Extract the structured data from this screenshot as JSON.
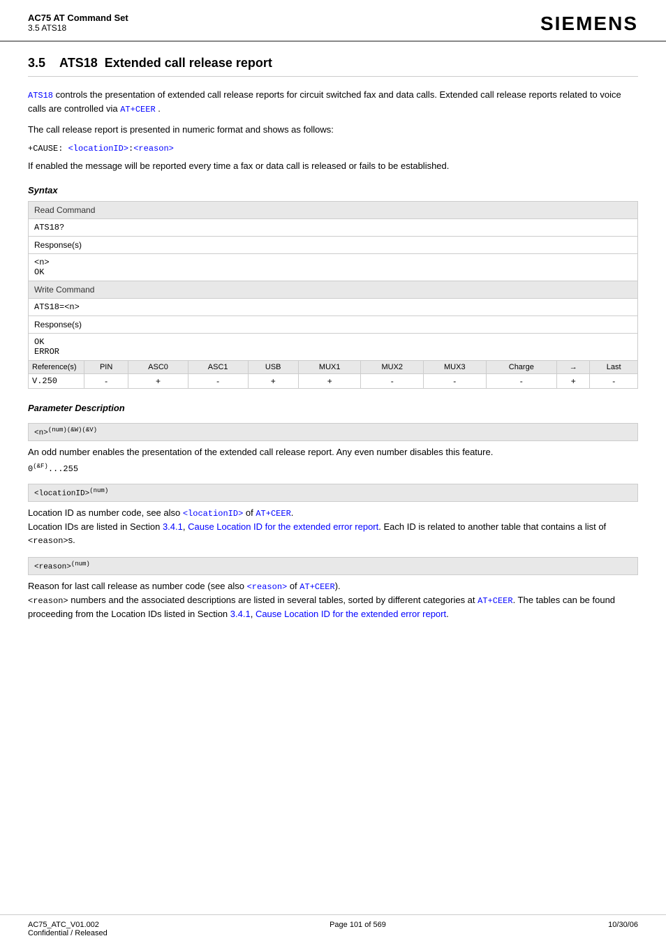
{
  "header": {
    "title": "AC75 AT Command Set",
    "subtitle": "3.5 ATS18",
    "logo": "SIEMENS"
  },
  "section": {
    "number": "3.5",
    "command": "ATS18",
    "title": "Extended call release report"
  },
  "body": {
    "para1_before": "controls the presentation of extended call release reports for circuit switched fax and data calls. Extended call release reports related to voice calls are controlled via",
    "para1_link1": "ATS18",
    "para1_link2": "AT+CEER",
    "para2": "The call release report is presented in numeric format and shows as follows:",
    "code_line": "+CAUSE: <locationID>:<reason>",
    "para3": "If enabled the message will be reported every time a fax or data call is released or fails to be established.",
    "syntax_heading": "Syntax",
    "param_desc_heading": "Parameter Description"
  },
  "syntax_table": {
    "read_command_label": "Read Command",
    "read_command": "ATS18?",
    "read_response_label": "Response(s)",
    "read_response_line1": "<n>",
    "read_response_line2": "OK",
    "write_command_label": "Write Command",
    "write_command": "ATS18=<n>",
    "write_response_label": "Response(s)",
    "write_response_line1": "OK",
    "write_response_line2": "ERROR",
    "ref_label": "Reference(s)",
    "ref_value": "V.250",
    "ref_headers": [
      "PIN",
      "ASC0",
      "ASC1",
      "USB",
      "MUX1",
      "MUX2",
      "MUX3",
      "Charge",
      "→",
      "Last"
    ],
    "ref_values": [
      "-",
      "+",
      "-",
      "+",
      "+",
      "-",
      "-",
      "-",
      "+",
      "-"
    ]
  },
  "params": [
    {
      "id": "<n>",
      "superscript": "(num)(&W)(&V)",
      "description": "An odd number enables the presentation of the extended call release report. Any even number disables this feature.",
      "range": "0(&F)...255"
    },
    {
      "id": "<locationID>",
      "superscript": "(num)",
      "description_before": "Location ID as number code, see also",
      "description_link1": "<locationID>",
      "description_mid": "of",
      "description_link2": "AT+CEER",
      "description_after": ".",
      "description2_before": "Location IDs are listed in Section",
      "description2_link1": "3.4.1",
      "description2_link2": "Cause Location ID for the extended error report",
      "description2_after": ". Each ID is related to another table that contains a list of",
      "description2_code": "<reason>",
      "description2_end": "s."
    },
    {
      "id": "<reason>",
      "superscript": "(num)",
      "description_before": "Reason for last call release as number code (see also",
      "description_link1": "<reason>",
      "description_mid": "of",
      "description_link2": "AT+CEER",
      "description_after": ").",
      "description2_before": "",
      "description2_code": "<reason>",
      "description2_mid": " numbers and the associated descriptions are listed in several tables, sorted by different categories at",
      "description2_link1": "AT+CEER",
      "description2_mid2": ". The tables can be found proceeding from the Location IDs listed in Section",
      "description2_link2": "3.4.1",
      "description2_link3": "Cause Location ID for the extended error report",
      "description2_end": "."
    }
  ],
  "footer": {
    "left_line1": "AC75_ATC_V01.002",
    "left_line2": "Confidential / Released",
    "center": "Page 101 of 569",
    "right": "10/30/06"
  }
}
